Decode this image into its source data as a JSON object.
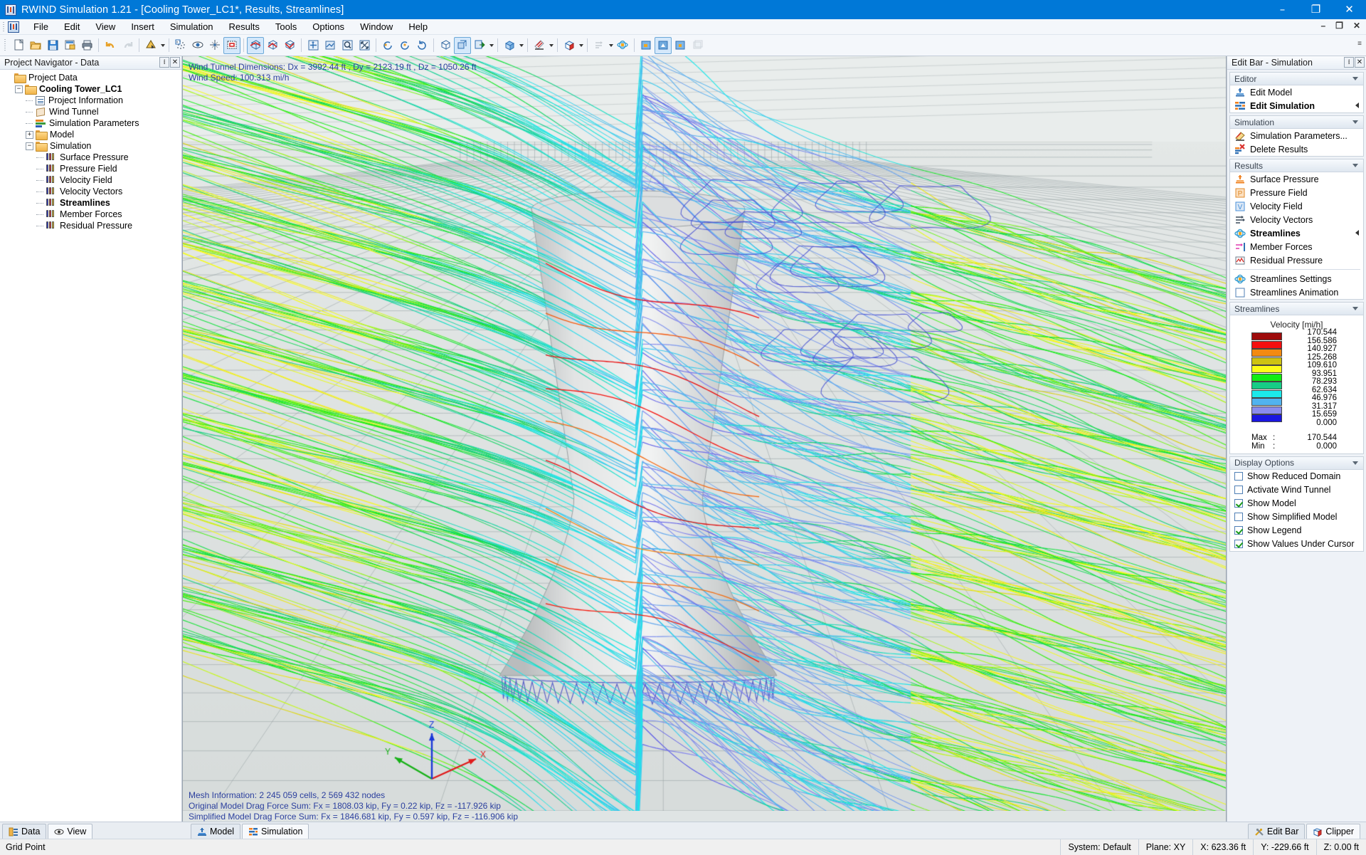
{
  "window": {
    "title": "RWIND Simulation 1.21 - [Cooling Tower_LC1*, Results, Streamlines]",
    "minimize": "–",
    "restore": "❐",
    "close": "✕",
    "mdi_minimize": "–",
    "mdi_restore": "❐",
    "mdi_close": "✕"
  },
  "menu": {
    "items": [
      {
        "label": "File"
      },
      {
        "label": "Edit"
      },
      {
        "label": "View"
      },
      {
        "label": "Insert"
      },
      {
        "label": "Simulation"
      },
      {
        "label": "Results"
      },
      {
        "label": "Tools"
      },
      {
        "label": "Options"
      },
      {
        "label": "Window"
      },
      {
        "label": "Help"
      }
    ]
  },
  "toolbar": {
    "overflow": "≡",
    "buttons": [
      {
        "name": "new-icon"
      },
      {
        "name": "open-icon"
      },
      {
        "name": "save-icon"
      },
      {
        "name": "print-preview-icon"
      },
      {
        "name": "print-icon"
      },
      {
        "name": "undo-icon"
      },
      {
        "name": "redo-icon"
      },
      {
        "name": "render-mode-icon"
      },
      {
        "name": "mesh-points-icon"
      },
      {
        "name": "visibility-icon"
      },
      {
        "name": "snap-grid-icon"
      },
      {
        "name": "selection-box-icon"
      },
      {
        "name": "view-iso-1-icon"
      },
      {
        "name": "view-iso-2-icon"
      },
      {
        "name": "view-iso-3-icon"
      },
      {
        "name": "pan-icon"
      },
      {
        "name": "zoom-window-icon"
      },
      {
        "name": "zoom-icon"
      },
      {
        "name": "zoom-all-icon"
      },
      {
        "name": "rotate-left-icon"
      },
      {
        "name": "rotate-center-icon"
      },
      {
        "name": "rotate-right-icon"
      },
      {
        "name": "wireframe-icon"
      },
      {
        "name": "solid-model-icon"
      },
      {
        "name": "wind-direction-icon"
      },
      {
        "name": "domain-box-icon"
      },
      {
        "name": "surface-pressure-icon"
      },
      {
        "name": "clipper-box-icon"
      },
      {
        "name": "velocity-vectors-icon"
      },
      {
        "name": "streamlines-icon"
      },
      {
        "name": "result-view-1-icon"
      },
      {
        "name": "result-view-2-icon"
      },
      {
        "name": "result-view-3-icon"
      },
      {
        "name": "result-view-4-icon"
      }
    ]
  },
  "navigator": {
    "title": "Project Navigator - Data",
    "pin": "᎒",
    "close": "✕",
    "tree": [
      {
        "label": "Project Data",
        "level": 0,
        "kind": "folder",
        "expander": "none",
        "bold": false
      },
      {
        "label": "Cooling Tower_LC1",
        "level": 1,
        "kind": "folder",
        "expander": "minus",
        "bold": true
      },
      {
        "label": "Project Information",
        "level": 2,
        "kind": "doc",
        "expander": "dash",
        "bold": false
      },
      {
        "label": "Wind Tunnel",
        "level": 2,
        "kind": "tunnel",
        "expander": "dash",
        "bold": false
      },
      {
        "label": "Simulation Parameters",
        "level": 2,
        "kind": "params",
        "expander": "dash",
        "bold": false
      },
      {
        "label": "Model",
        "level": 2,
        "kind": "folder",
        "expander": "plus",
        "bold": false
      },
      {
        "label": "Simulation",
        "level": 2,
        "kind": "folder",
        "expander": "minus",
        "bold": false
      },
      {
        "label": "Surface Pressure",
        "level": 3,
        "kind": "result",
        "expander": "dash",
        "bold": false
      },
      {
        "label": "Pressure Field",
        "level": 3,
        "kind": "result",
        "expander": "dash",
        "bold": false
      },
      {
        "label": "Velocity Field",
        "level": 3,
        "kind": "result",
        "expander": "dash",
        "bold": false
      },
      {
        "label": "Velocity Vectors",
        "level": 3,
        "kind": "result",
        "expander": "dash",
        "bold": false
      },
      {
        "label": "Streamlines",
        "level": 3,
        "kind": "result",
        "expander": "dash",
        "bold": true
      },
      {
        "label": "Member Forces",
        "level": 3,
        "kind": "result",
        "expander": "dash",
        "bold": false
      },
      {
        "label": "Residual Pressure",
        "level": 3,
        "kind": "result",
        "expander": "dash",
        "bold": false
      }
    ],
    "tabs": [
      {
        "label": "Data",
        "active": false,
        "icon": "data-icon"
      },
      {
        "label": "View",
        "active": true,
        "icon": "eye-icon"
      }
    ]
  },
  "viewport": {
    "overlay_top": [
      "Wind Tunnel Dimensions: Dx = 3992.44 ft , Dy = 2123.19 ft , Dz = 1050.26 ft",
      "Wind Speed: 100.313 mi/h"
    ],
    "overlay_bottom": [
      "Mesh Information: 2 245 059 cells, 2 569 432 nodes",
      "Original Model Drag Force Sum: Fx = 1808.03 kip, Fy = 0.22 kip, Fz = -117.926 kip",
      "Simplified Model Drag Force Sum: Fx = 1846.681 kip, Fy = 0.597 kip, Fz = -116.906 kip"
    ],
    "axis": {
      "x": "X",
      "y": "Y",
      "z": "Z",
      "x_color": "#e01b1b",
      "y_color": "#17b117",
      "z_color": "#1a37d8"
    },
    "tabs": [
      {
        "label": "Model",
        "active": false,
        "icon": "model-icon"
      },
      {
        "label": "Simulation",
        "active": true,
        "icon": "simulation-icon"
      }
    ]
  },
  "editbar": {
    "title": "Edit Bar - Simulation",
    "pin": "᎒",
    "close": "✕",
    "groups": [
      {
        "title": "Editor",
        "items": [
          {
            "label": "Edit Model",
            "icon": "edit-model-icon",
            "bold": false,
            "mark": false
          },
          {
            "label": "Edit Simulation",
            "icon": "edit-simulation-icon",
            "bold": true,
            "mark": true
          }
        ]
      },
      {
        "title": "Simulation",
        "items": [
          {
            "label": "Simulation Parameters...",
            "icon": "simulation-parameters-icon",
            "bold": false,
            "mark": false
          },
          {
            "label": "Delete Results",
            "icon": "delete-results-icon",
            "bold": false,
            "mark": false
          }
        ]
      },
      {
        "title": "Results",
        "items": [
          {
            "label": "Surface Pressure",
            "icon": "surface-pressure-icon",
            "bold": false,
            "mark": false
          },
          {
            "label": "Pressure Field",
            "icon": "pressure-field-icon",
            "bold": false,
            "mark": false
          },
          {
            "label": "Velocity Field",
            "icon": "velocity-field-icon",
            "bold": false,
            "mark": false
          },
          {
            "label": "Velocity Vectors",
            "icon": "velocity-vectors-icon",
            "bold": false,
            "mark": false
          },
          {
            "label": "Streamlines",
            "icon": "streamlines-icon",
            "bold": true,
            "mark": true
          },
          {
            "label": "Member Forces",
            "icon": "member-forces-icon",
            "bold": false,
            "mark": false
          },
          {
            "label": "Residual Pressure",
            "icon": "residual-pressure-icon",
            "bold": false,
            "mark": false
          },
          {
            "label": "Streamlines Settings",
            "icon": "streamlines-settings-icon",
            "bold": false,
            "mark": false,
            "sep_before": true
          },
          {
            "label": "Streamlines Animation",
            "icon": "streamlines-animation-icon",
            "bold": false,
            "mark": false
          }
        ]
      }
    ],
    "legend_group_title": "Streamlines",
    "display_options_title": "Display Options",
    "display_options": [
      {
        "label": "Show Reduced Domain",
        "checked": false
      },
      {
        "label": "Activate Wind Tunnel",
        "checked": false
      },
      {
        "label": "Show Model",
        "checked": true
      },
      {
        "label": "Show Simplified Model",
        "checked": false
      },
      {
        "label": "Show Legend",
        "checked": true
      },
      {
        "label": "Show Values Under Cursor",
        "checked": true
      }
    ],
    "tabs": [
      {
        "label": "Edit Bar",
        "active": false,
        "icon": "tools-icon"
      },
      {
        "label": "Clipper",
        "active": true,
        "icon": "clipper-icon"
      }
    ]
  },
  "chart_data": {
    "type": "heatmap",
    "title": "Velocity [mi/h]",
    "unit": "mi/h",
    "quantity": "Velocity",
    "colors": [
      "#9e0b0b",
      "#f50f0f",
      "#f38a11",
      "#cec312",
      "#fdfd18",
      "#13ed13",
      "#17cd86",
      "#1ce9ea",
      "#51b3ef",
      "#8a8ced",
      "#1a16e0"
    ],
    "tick_values": [
      "170.544",
      "156.586",
      "140.927",
      "125.268",
      "109.610",
      "93.951",
      "78.293",
      "62.634",
      "46.976",
      "31.317",
      "15.659",
      "0.000"
    ],
    "max_label": "Max",
    "min_label": "Min",
    "colon": ":",
    "max_value": "170.544",
    "min_value": "0.000"
  },
  "statusbar": {
    "left": "Grid Point",
    "cells": [
      {
        "label": "System: Default"
      },
      {
        "label": "Plane: XY"
      },
      {
        "label": "X:  623.36 ft"
      },
      {
        "label": "Y:  -229.66 ft"
      },
      {
        "label": "Z:  0.00 ft"
      }
    ]
  }
}
